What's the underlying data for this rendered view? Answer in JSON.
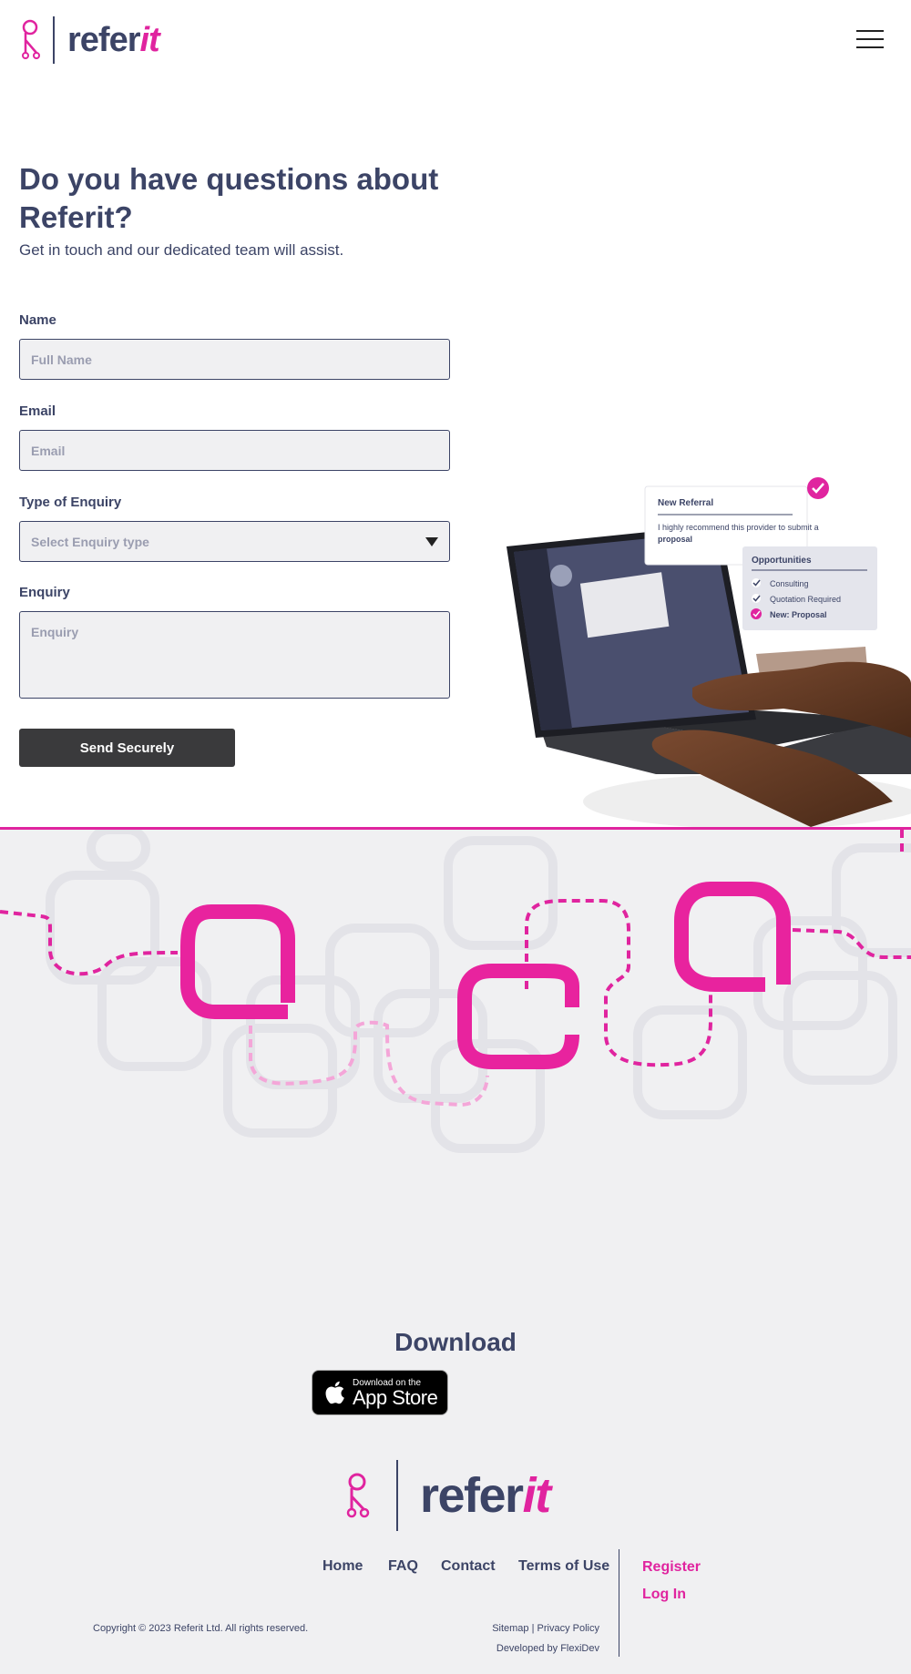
{
  "header": {
    "brand_main": "refer",
    "brand_accent": "it",
    "menu_icon": "hamburger-icon"
  },
  "hero": {
    "title": "Do you have questions about Referit?",
    "subtitle": "Get in touch and our dedicated team will assist."
  },
  "form": {
    "name_label": "Name",
    "name_placeholder": "Full Name",
    "email_label": "Email",
    "email_placeholder": "Email",
    "type_label": "Type of Enquiry",
    "type_placeholder": "Select Enquiry type",
    "enquiry_label": "Enquiry",
    "enquiry_placeholder": "Enquiry",
    "submit_label": "Send Securely"
  },
  "illustration": {
    "card1_title": "New Referral",
    "card1_text": "I highly recommend this provider to submit a",
    "card1_bold": "proposal",
    "card2_title": "Opportunities",
    "card2_items": [
      "Consulting",
      "Quotation Required",
      "New: Proposal"
    ]
  },
  "footer": {
    "download_title": "Download",
    "appstore_small": "Download on the",
    "appstore_big": "App Store",
    "brand_main": "refer",
    "brand_accent": "it",
    "nav": [
      "Home",
      "FAQ",
      "Contact",
      "Terms of Use"
    ],
    "register": "Register",
    "login": "Log In",
    "copyright": "Copyright © 2023 Referit Ltd. All rights reserved.",
    "sitemap": "Sitemap",
    "privacy": "Privacy Policy",
    "developed": "Developed by FlexiDev"
  },
  "colors": {
    "accent": "#e0249f",
    "navy": "#3c4466",
    "button": "#3a3a3c",
    "footer_bg": "#f0f0f2"
  }
}
